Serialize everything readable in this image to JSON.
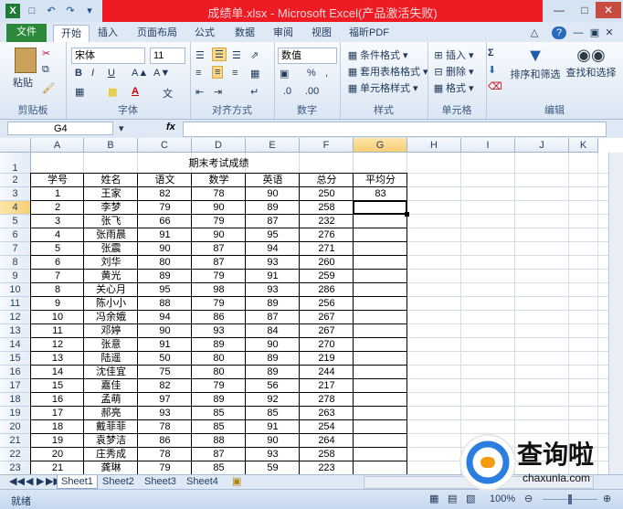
{
  "window": {
    "title": "成绩单.xlsx - Microsoft Excel(产品激活失败)"
  },
  "ribbon_tabs": [
    "文件",
    "开始",
    "插入",
    "页面布局",
    "公式",
    "数据",
    "审阅",
    "视图",
    "福昕PDF"
  ],
  "ribbon": {
    "clipboard": {
      "label": "剪贴板",
      "paste": "粘贴"
    },
    "font": {
      "label": "字体",
      "name": "宋体",
      "size": "11",
      "bold": "B",
      "italic": "I",
      "underline": "U",
      "color_letter": "A"
    },
    "alignment": {
      "label": "对齐方式"
    },
    "number": {
      "label": "数字",
      "format": "数值",
      "percent": "%",
      "comma": ","
    },
    "styles": {
      "label": "样式",
      "conditional": "条件格式",
      "table": "套用表格格式",
      "cell_style": "单元格样式"
    },
    "cells": {
      "label": "单元格",
      "insert": "插入",
      "delete": "删除",
      "format": "格式"
    },
    "editing": {
      "label": "编辑",
      "sum": "Σ",
      "sort": "排序和筛选",
      "find": "查找和选择"
    }
  },
  "formula_bar": {
    "name_box": "G4",
    "fx": "fx",
    "value": ""
  },
  "columns": [
    "A",
    "B",
    "C",
    "D",
    "E",
    "F",
    "G",
    "H",
    "I",
    "J",
    "K"
  ],
  "selected_cell": "G4",
  "sheet": {
    "title": "期末考试成绩",
    "headers": [
      "学号",
      "姓名",
      "语文",
      "数学",
      "英语",
      "总分",
      "平均分"
    ],
    "rows": [
      [
        "1",
        "王家",
        "82",
        "78",
        "90",
        "250",
        "83"
      ],
      [
        "2",
        "李梦",
        "79",
        "90",
        "89",
        "258",
        ""
      ],
      [
        "3",
        "张飞",
        "66",
        "79",
        "87",
        "232",
        ""
      ],
      [
        "4",
        "张雨晨",
        "91",
        "90",
        "95",
        "276",
        ""
      ],
      [
        "5",
        "张震",
        "90",
        "87",
        "94",
        "271",
        ""
      ],
      [
        "6",
        "刘华",
        "80",
        "87",
        "93",
        "260",
        ""
      ],
      [
        "7",
        "黄光",
        "89",
        "79",
        "91",
        "259",
        ""
      ],
      [
        "8",
        "关心月",
        "95",
        "98",
        "93",
        "286",
        ""
      ],
      [
        "9",
        "陈小小",
        "88",
        "79",
        "89",
        "256",
        ""
      ],
      [
        "10",
        "冯余娥",
        "94",
        "86",
        "87",
        "267",
        ""
      ],
      [
        "11",
        "邓婷",
        "90",
        "93",
        "84",
        "267",
        ""
      ],
      [
        "12",
        "张意",
        "91",
        "89",
        "90",
        "270",
        ""
      ],
      [
        "13",
        "陆遥",
        "50",
        "80",
        "89",
        "219",
        ""
      ],
      [
        "14",
        "沈佳宜",
        "75",
        "80",
        "89",
        "244",
        ""
      ],
      [
        "15",
        "嘉佳",
        "82",
        "79",
        "56",
        "217",
        ""
      ],
      [
        "16",
        "孟萌",
        "97",
        "89",
        "92",
        "278",
        ""
      ],
      [
        "17",
        "郝亮",
        "93",
        "85",
        "85",
        "263",
        ""
      ],
      [
        "18",
        "戴菲菲",
        "78",
        "85",
        "91",
        "254",
        ""
      ],
      [
        "19",
        "袁梦洁",
        "86",
        "88",
        "90",
        "264",
        ""
      ],
      [
        "20",
        "庄秀成",
        "78",
        "87",
        "93",
        "258",
        ""
      ],
      [
        "21",
        "龚琳",
        "79",
        "85",
        "59",
        "223",
        ""
      ]
    ]
  },
  "sheet_tabs": [
    "Sheet1",
    "Sheet2",
    "Sheet3",
    "Sheet4"
  ],
  "status": {
    "ready": "就绪",
    "zoom": "100%"
  },
  "watermark": {
    "text": "查询啦",
    "url": "chaxunla.com"
  },
  "colors": {
    "title_bg": "#ee1b24",
    "file_tab": "#2a8a3a",
    "select_header": "#f8cd74"
  }
}
